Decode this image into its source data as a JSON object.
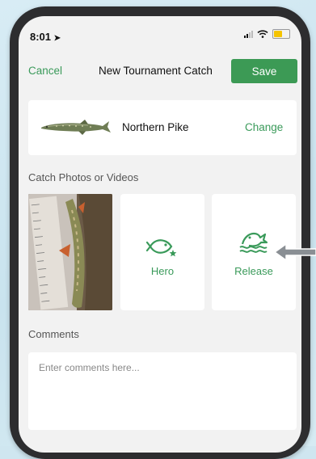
{
  "status_bar": {
    "time": "8:01"
  },
  "nav": {
    "cancel_label": "Cancel",
    "title": "New Tournament Catch",
    "save_label": "Save"
  },
  "species": {
    "name": "Northern Pike",
    "change_label": "Change"
  },
  "photos": {
    "section_label": "Catch Photos or Videos",
    "tiles": [
      {
        "label": "Hero",
        "icon": "fish-star-icon"
      },
      {
        "label": "Release",
        "icon": "fish-jumping-water-icon"
      }
    ]
  },
  "comments": {
    "section_label": "Comments",
    "placeholder": "Enter comments here..."
  },
  "colors": {
    "accent_green": "#3c9a55",
    "battery_yellow": "#f5c400"
  }
}
